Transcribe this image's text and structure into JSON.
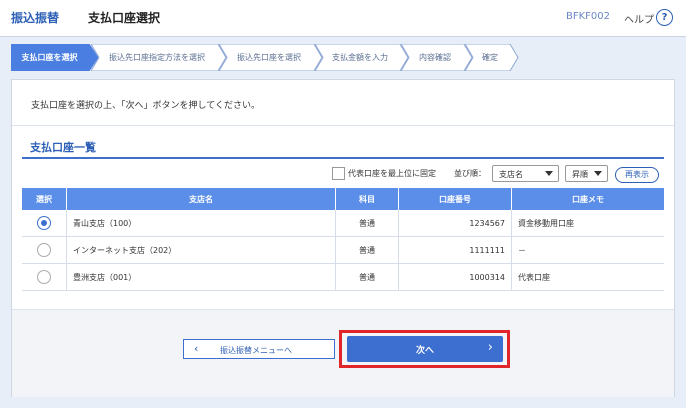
{
  "header": {
    "app": "振込振替",
    "title": "支払口座選択",
    "code": "BFKF002",
    "help": "ヘルプ",
    "help_icon": "?"
  },
  "steps": [
    {
      "label": "支払口座を選択",
      "active": true
    },
    {
      "label": "振込先口座指定方法を選択",
      "active": false
    },
    {
      "label": "振込先口座を選択",
      "active": false
    },
    {
      "label": "支払金額を入力",
      "active": false
    },
    {
      "label": "内容確認",
      "active": false
    },
    {
      "label": "確定",
      "active": false
    }
  ],
  "intro": "支払口座を選択の上、「次へ」ボタンを押してください。",
  "list": {
    "title": "支払口座一覧",
    "pin_label": "代表口座を最上位に固定",
    "sort_label": "並び順：",
    "sort_field": "支店名",
    "sort_order": "昇順",
    "redisplay": "再表示",
    "columns": [
      "選択",
      "支店名",
      "科目",
      "口座番号",
      "口座メモ"
    ],
    "rows": [
      {
        "selected": true,
        "branch": "青山支店（100）",
        "type": "普通",
        "number": "1234567",
        "memo": "資金移動用口座"
      },
      {
        "selected": false,
        "branch": "インターネット支店（202）",
        "type": "普通",
        "number": "1111111",
        "memo": "－"
      },
      {
        "selected": false,
        "branch": "豊洲支店（001）",
        "type": "普通",
        "number": "1000314",
        "memo": "代表口座"
      }
    ]
  },
  "buttons": {
    "back": "振込振替メニューへ",
    "back_icon": "‹",
    "next": "次へ",
    "next_icon": "›"
  },
  "colors": {
    "accent": "#3c6fd0",
    "header_row": "#5a8ee8",
    "highlight": "#e0252b"
  }
}
